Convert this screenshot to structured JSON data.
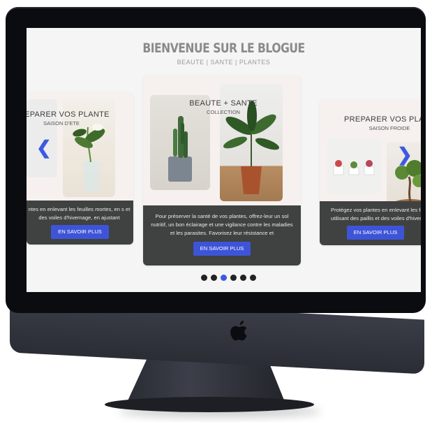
{
  "blog": {
    "title": "BIENVENUE SUR LE BLOGUE",
    "subtitle": "BEAUTE | SANTE | PLANTES"
  },
  "cards": [
    {
      "title": "PREPARER VOS PLANTE",
      "subtitle": "SAISON D'ETE",
      "text": "ntes en enlevant les feuilles mortes, en s et des voiles d'hivernage, en ajustant",
      "button": "EN SAVOIR PLUS"
    },
    {
      "title": "BEAUTE + SANTE",
      "subtitle": "COLLECTION",
      "text": "Pour préserver la santé de vos plantes, offrez-leur un sol nutritif, un bon éclairage et une vigilance contre les maladies et les parasites. Favorisez leur résistance et",
      "button": "EN SAVOIR PLUS"
    },
    {
      "title": "PREPARER VOS PLANT",
      "subtitle": "SAISON FROIDE",
      "text": "Protégez vos plantes en enlevant les fe utilisant des paillis et des voiles d'hiver",
      "button": "EN SAVOIR PLUS"
    }
  ],
  "carousel": {
    "dots": 6,
    "active_index": 2,
    "accent": "#3d5ae0"
  },
  "icons": {
    "prev": "chevron-left-icon",
    "next": "chevron-right-icon",
    "brand": "apple-logo-icon"
  }
}
